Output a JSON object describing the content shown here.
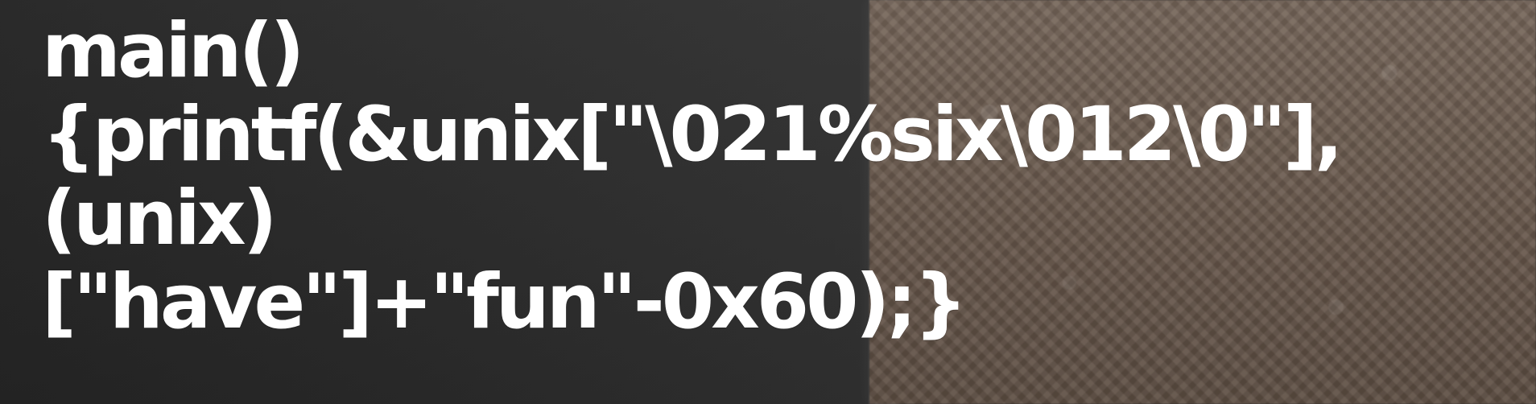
{
  "hero": {
    "headline_lines": [
      "main()",
      "{printf(&unix[\"\\021%six\\012\\0\"],",
      "(unix)",
      "[\"have\"]+\"fun\"-0x60);}"
    ]
  }
}
